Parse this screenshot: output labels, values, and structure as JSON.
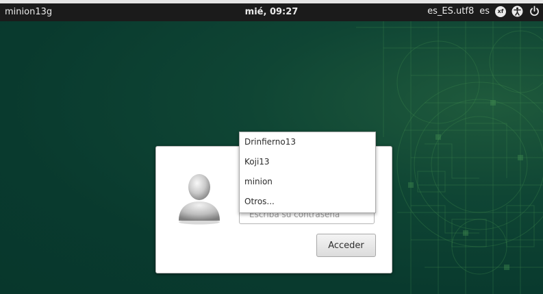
{
  "topbar": {
    "hostname": "minion13g",
    "datetime": "mié, 09:27",
    "locale": "es_ES.utf8",
    "keyboard_layout": "es",
    "status_icons": [
      "xf-icon",
      "accessibility-icon",
      "power-icon"
    ],
    "xf_icon_text": "xf"
  },
  "login": {
    "password_placeholder": "Escriba su contraseña",
    "submit_label": "Acceder"
  },
  "user_menu": {
    "items": [
      {
        "label": "Drinfierno13"
      },
      {
        "label": "Koji13"
      },
      {
        "label": "minion"
      },
      {
        "label": "Otros..."
      }
    ]
  },
  "colors": {
    "topbar_bg": "#1b1b1b",
    "background": "#0a3d30",
    "dialog_bg": "#ffffff"
  }
}
